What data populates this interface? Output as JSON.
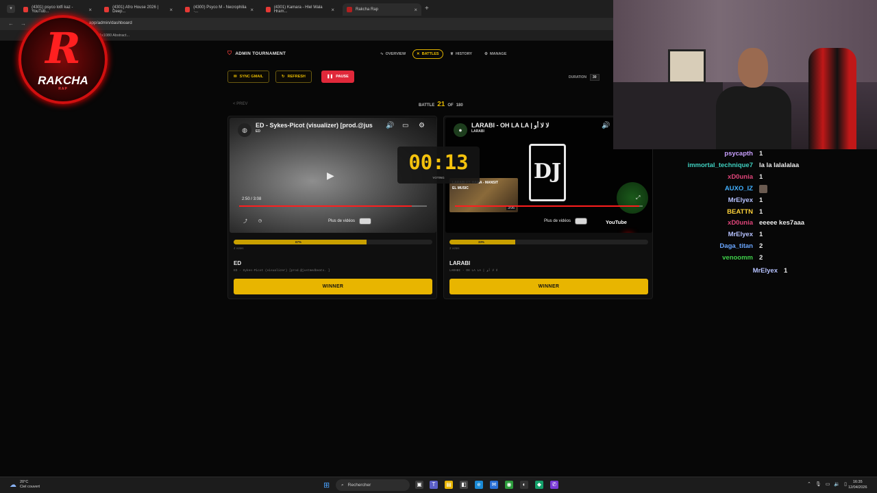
{
  "browser": {
    "tabs": [
      {
        "label": "(4301) psyco lotfi kaz - YouTub..."
      },
      {
        "label": "(4301) Afro House 2026 | Deep..."
      },
      {
        "label": "(4300) Psyco M - Necrophilia ·..."
      },
      {
        "label": "(4301) Kamara - Hlel Wala Hram..."
      },
      {
        "label": "Rakcha Rap"
      }
    ],
    "url": ".app/admin/dashboard",
    "bookmark": "1x1080 Abstract..."
  },
  "logo": {
    "letter": "R",
    "word": "RAKCHA",
    "sub": "RAP"
  },
  "app": {
    "brand": "ADMIN TOURNAMENT",
    "nav": [
      {
        "label": "OVERVIEW",
        "icon": "pulse-icon"
      },
      {
        "label": "BATTLES",
        "icon": "swords-icon"
      },
      {
        "label": "HISTORY",
        "icon": "trophy-icon"
      },
      {
        "label": "MANAGE",
        "icon": "gear-icon"
      }
    ],
    "buttons": {
      "sync": "SYNC GMAIL",
      "refresh": "REFRESH",
      "pause": "PAUSE"
    },
    "duration_label": "DURATION",
    "duration_value": "30",
    "prev": "< PREV",
    "battle_label": "BATTLE",
    "battle_current": "21",
    "battle_of": "OF",
    "battle_total": "180"
  },
  "timer": {
    "value": "00:13",
    "label": "VOTING"
  },
  "left": {
    "video_title": "ED - Sykes-Picot (visualizer) [prod.@jus",
    "video_channel": "ED",
    "time": "2:50 / 3:08",
    "progress": 0.92,
    "more_videos": "Plus de vidéos",
    "vote_pct": 0.67,
    "vote_pct_label": "67%",
    "votes": "4 votes",
    "name": "ED",
    "desc": "ED - Sykes-Picot (visualizer) [prod.@justmedbeats. ]",
    "winner": "WINNER"
  },
  "right": {
    "video_title": "LARABI - OH LA LA | لا لا أو",
    "video_channel": "LARABI",
    "thumb_title": "LARABI FT. HAMA - MANSIT",
    "thumb_sub": "EL MUSIC",
    "thumb_dur": "3:06",
    "progress": 0.98,
    "more_videos": "Plus de vidéos",
    "youtube": "YouTube",
    "vote_pct": 0.33,
    "vote_pct_label": "33%",
    "votes": "2 votes",
    "name": "LARABI",
    "desc": "LARABI - OH LA LA | لا لا أو",
    "winner": "WINNER"
  },
  "chat": [
    {
      "user": "psycapth",
      "msg": "1",
      "color": "#c9a0ff"
    },
    {
      "user": "immortal_technique7",
      "msg": "la la lalalalaa",
      "color": "#3fd0c0"
    },
    {
      "user": "xD0unia",
      "msg": "1",
      "color": "#e0457a"
    },
    {
      "user": "AUXO_IZ",
      "msg": "",
      "color": "#42b0ff",
      "emote": true
    },
    {
      "user": "MrElyex",
      "msg": "1",
      "color": "#b6c2ff"
    },
    {
      "user": "BEATTN",
      "msg": "1",
      "color": "#ffd23a"
    },
    {
      "user": "xD0unia",
      "msg": "eeeee kes7aaa",
      "color": "#e0457a"
    },
    {
      "user": "MrElyex",
      "msg": "1",
      "color": "#b6c2ff"
    },
    {
      "user": "Daga_titan",
      "msg": "2",
      "color": "#6aa6ff"
    },
    {
      "user": "venoomm",
      "msg": "2",
      "color": "#3fd04a"
    },
    {
      "user": "MrElyex",
      "msg": "1",
      "color": "#b6c2ff"
    }
  ],
  "taskbar": {
    "temp": "20°C",
    "weather": "Ciel couvert",
    "search": "Rechercher",
    "time": "16:35",
    "date": "12/04/2026"
  }
}
